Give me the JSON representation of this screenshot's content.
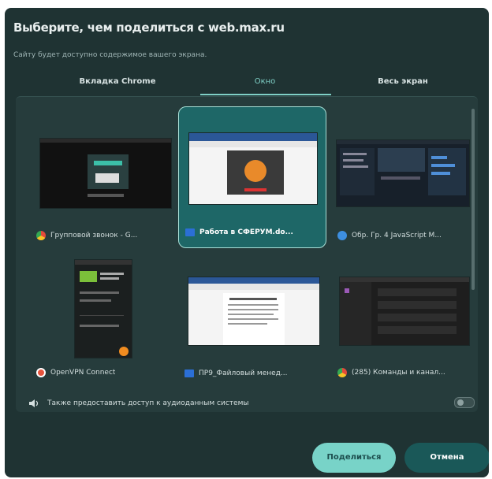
{
  "dialog": {
    "title": "Выберите, чем поделиться с web.max.ru",
    "subtitle": "Сайту будет доступно содержимое вашего экрана."
  },
  "tabs": [
    {
      "label": "Вкладка Chrome",
      "active": false
    },
    {
      "label": "Окно",
      "active": true
    },
    {
      "label": "Весь экран",
      "active": false
    }
  ],
  "windows": [
    {
      "label": "Групповой звонок - G...",
      "icon": "chrome-icon",
      "selected": false
    },
    {
      "label": "Работа в СФЕРУМ.do...",
      "icon": "word-icon",
      "selected": true
    },
    {
      "label": "Обр. Гр. 4 JavaScript M...",
      "icon": "app-icon",
      "selected": false
    },
    {
      "label": "OpenVPN Connect",
      "icon": "openvpn-icon",
      "selected": false
    },
    {
      "label": "ПР9_Файловый менед...",
      "icon": "word-icon",
      "selected": false
    },
    {
      "label": "(285) Команды и канал...",
      "icon": "chrome-icon",
      "selected": false
    }
  ],
  "audio": {
    "label": "Также предоставить доступ к аудиоданным системы",
    "enabled": false
  },
  "buttons": {
    "share": "Поделиться",
    "cancel": "Отмена"
  },
  "colors": {
    "dialog_bg": "#1f3333",
    "accent": "#7fd0c6",
    "selected_card": "#1e6767"
  }
}
